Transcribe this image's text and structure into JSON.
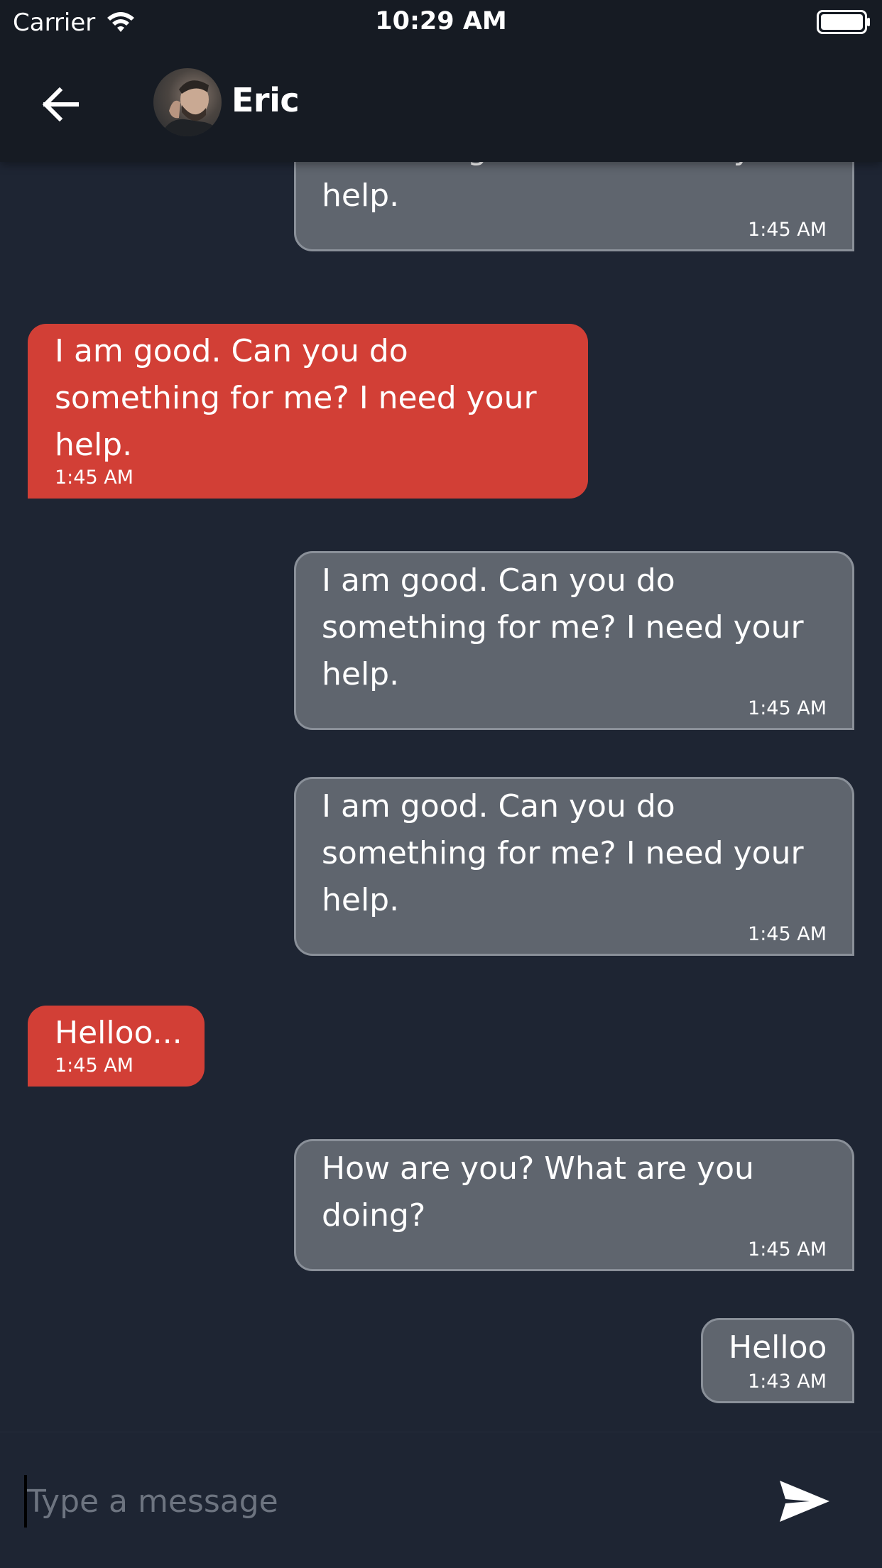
{
  "status_bar": {
    "carrier": "Carrier",
    "time": "10:29 AM"
  },
  "header": {
    "contact_name": "Eric",
    "back_icon": "arrow-left-icon",
    "avatar": "contact-avatar"
  },
  "messages": [
    {
      "direction": "out",
      "text": "something for me? I need your\nhelp.",
      "time": "1:45 AM"
    },
    {
      "direction": "in",
      "text": "I am good. Can you do\nsomething for me? I need your\nhelp.",
      "time": "1:45 AM"
    },
    {
      "direction": "out",
      "text": "I am good. Can you do\nsomething for me? I need your\nhelp.",
      "time": "1:45 AM"
    },
    {
      "direction": "out",
      "text": "I am good. Can you do\nsomething for me? I need your\nhelp.",
      "time": "1:45 AM"
    },
    {
      "direction": "in",
      "text": "Helloo...",
      "time": "1:45 AM"
    },
    {
      "direction": "out",
      "text": "How are you? What are you\ndoing?",
      "time": "1:45 AM"
    },
    {
      "direction": "out",
      "text": "Helloo",
      "time": "1:43 AM"
    }
  ],
  "composer": {
    "placeholder": "Type a message",
    "value": "",
    "send_icon": "send-icon"
  },
  "colors": {
    "background": "#1e2533",
    "header": "#161b23",
    "incoming_bubble": "#d23f36",
    "outgoing_bubble": "#5f656e",
    "outgoing_border": "#8a9099",
    "placeholder": "#6d7480"
  }
}
